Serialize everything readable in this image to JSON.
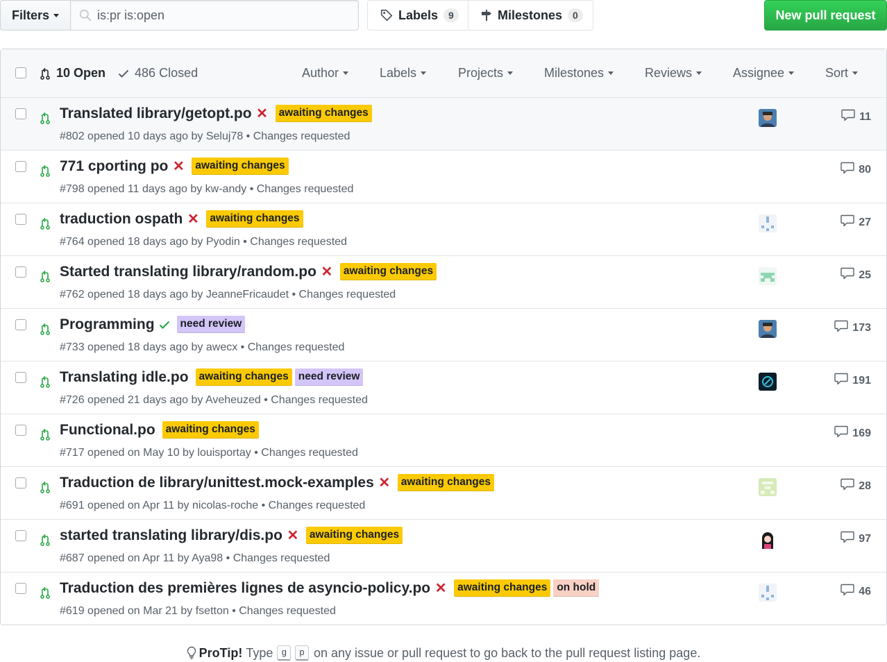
{
  "toolbar": {
    "filters_label": "Filters",
    "search_value": "is:pr is:open",
    "labels_label": "Labels",
    "labels_count": "9",
    "milestones_label": "Milestones",
    "milestones_count": "0",
    "new_pr_label": "New pull request"
  },
  "header": {
    "open_label": "10 Open",
    "closed_label": "486 Closed",
    "menus": {
      "author": "Author",
      "labels": "Labels",
      "projects": "Projects",
      "milestones": "Milestones",
      "reviews": "Reviews",
      "assignee": "Assignee",
      "sort": "Sort"
    }
  },
  "colors": {
    "awaiting_changes": "#fbca04",
    "need_review": "#d4c5f9",
    "on_hold": "#f9d0c4",
    "open_green": "#28a745",
    "failure_red": "#cb2431"
  },
  "pull_requests": [
    {
      "title": "Translated library/getopt.po",
      "status": "failure",
      "labels": [
        "awaiting changes"
      ],
      "number": "#802",
      "opened": "opened 10 days ago by",
      "author": "Seluj78",
      "review": "Changes requested",
      "comments": "11",
      "avatar": "photo-blue"
    },
    {
      "title": "771 cporting po",
      "status": "failure",
      "labels": [
        "awaiting changes"
      ],
      "number": "#798",
      "opened": "opened 11 days ago by",
      "author": "kw-andy",
      "review": "Changes requested",
      "comments": "80",
      "avatar": ""
    },
    {
      "title": "traduction ospath",
      "status": "failure",
      "labels": [
        "awaiting changes"
      ],
      "number": "#764",
      "opened": "opened 18 days ago by",
      "author": "Pyodin",
      "review": "Changes requested",
      "comments": "27",
      "avatar": "identicon-blue"
    },
    {
      "title": "Started translating library/random.po",
      "status": "failure",
      "labels": [
        "awaiting changes"
      ],
      "number": "#762",
      "opened": "opened 18 days ago by",
      "author": "JeanneFricaudet",
      "review": "Changes requested",
      "comments": "25",
      "avatar": "identicon-green"
    },
    {
      "title": "Programming",
      "status": "success",
      "labels": [
        "need review"
      ],
      "number": "#733",
      "opened": "opened 18 days ago by",
      "author": "awecx",
      "review": "Changes requested",
      "comments": "173",
      "avatar": "photo-blue"
    },
    {
      "title": "Translating idle.po",
      "status": "none",
      "labels": [
        "awaiting changes",
        "need review"
      ],
      "number": "#726",
      "opened": "opened 21 days ago by",
      "author": "Aveheuzed",
      "review": "Changes requested",
      "comments": "191",
      "avatar": "dark-logo"
    },
    {
      "title": "Functional.po",
      "status": "none",
      "labels": [
        "awaiting changes"
      ],
      "number": "#717",
      "opened": "opened on May 10 by",
      "author": "louisportay",
      "review": "Changes requested",
      "comments": "169",
      "avatar": ""
    },
    {
      "title": "Traduction de library/unittest.mock-examples",
      "status": "failure",
      "labels": [
        "awaiting changes"
      ],
      "number": "#691",
      "opened": "opened on Apr 11 by",
      "author": "nicolas-roche",
      "review": "Changes requested",
      "comments": "28",
      "avatar": "identicon-lime"
    },
    {
      "title": "started translating library/dis.po",
      "status": "failure",
      "labels": [
        "awaiting changes"
      ],
      "number": "#687",
      "opened": "opened on Apr 11 by",
      "author": "Aya98",
      "review": "Changes requested",
      "comments": "97",
      "avatar": "illustration"
    },
    {
      "title": "Traduction des premières lignes de asyncio-policy.po",
      "status": "failure",
      "labels": [
        "awaiting changes",
        "on hold"
      ],
      "number": "#619",
      "opened": "opened on Mar 21 by",
      "author": "fsetton",
      "review": "Changes requested",
      "comments": "46",
      "avatar": "identicon-blue"
    }
  ],
  "protip": {
    "title": "ProTip!",
    "before": "Type",
    "key1": "g",
    "key2": "p",
    "after": "on any issue or pull request to go back to the pull request listing page."
  }
}
